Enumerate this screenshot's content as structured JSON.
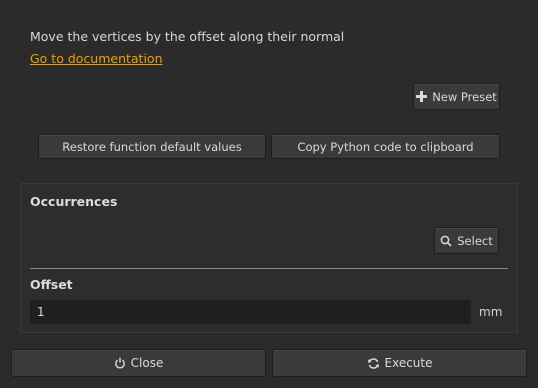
{
  "description": "Move the vertices by the offset along their normal",
  "doc_link": "Go to documentation",
  "toolbar": {
    "new_preset_label": "New Preset",
    "restore_label": "Restore function default values",
    "copy_label": "Copy Python code to clipboard"
  },
  "occurrences": {
    "label": "Occurrences",
    "select_label": "Select"
  },
  "offset": {
    "label": "Offset",
    "value": "1",
    "unit": "mm"
  },
  "footer": {
    "close_label": "Close",
    "execute_label": "Execute"
  },
  "icons": {
    "new_preset": "plus-icon",
    "select": "search-icon",
    "close": "power-icon",
    "execute": "refresh-icon"
  },
  "colors": {
    "background": "#2b2b2b",
    "link": "#f0a000",
    "input_bg": "#1f1f1f"
  }
}
